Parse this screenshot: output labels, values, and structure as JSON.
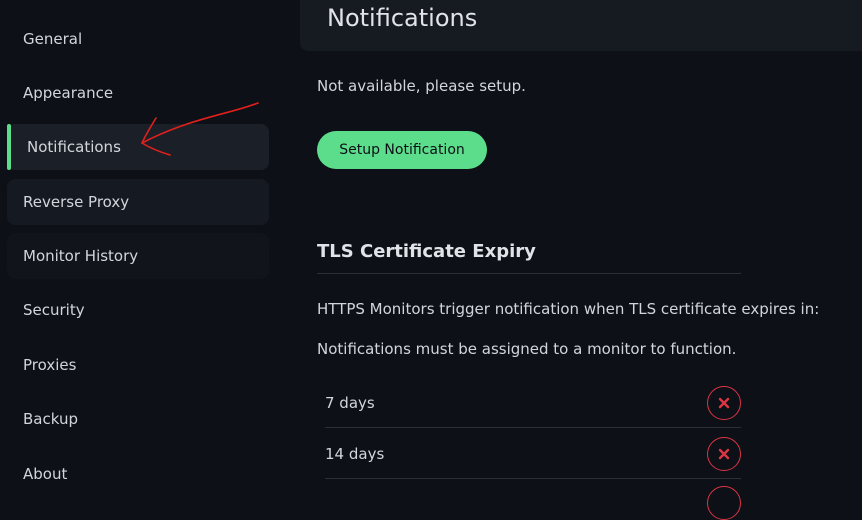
{
  "sidebar": {
    "items": [
      {
        "label": "General"
      },
      {
        "label": "Appearance"
      },
      {
        "label": "Notifications"
      },
      {
        "label": "Reverse Proxy"
      },
      {
        "label": "Monitor History"
      },
      {
        "label": "Security"
      },
      {
        "label": "Proxies"
      },
      {
        "label": "Backup"
      },
      {
        "label": "About"
      }
    ],
    "active": "Notifications"
  },
  "header": {
    "title": "Notifications"
  },
  "notifications": {
    "status": "Not available, please setup.",
    "setup_button": "Setup Notification"
  },
  "tls": {
    "title": "TLS Certificate Expiry",
    "description": "HTTPS Monitors trigger notification when TLS certificate expires in:",
    "note": "Notifications must be assigned to a monitor to function.",
    "days": [
      "7 days",
      "14 days"
    ]
  },
  "colors": {
    "accent": "#5cdd8b",
    "danger": "#dc3545",
    "background": "#0d1016",
    "header_bg": "#161b22",
    "annotation": "#e0201c"
  },
  "icons": {
    "remove": "close-x-icon",
    "annotation": "arrow-annotation"
  }
}
